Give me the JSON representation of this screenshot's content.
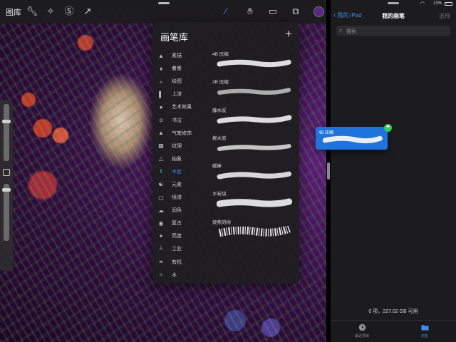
{
  "left_app": {
    "gallery_label": "图库",
    "toolbar_icons": [
      "wrench-icon",
      "magic-wand-icon",
      "selection-icon",
      "transform-arrow-icon"
    ],
    "right_tools": [
      "brush-icon",
      "smudge-icon",
      "eraser-icon",
      "layers-icon"
    ],
    "current_color": "#5b2686"
  },
  "brush_library": {
    "title": "画笔库",
    "add_label": "+",
    "categories": [
      {
        "label": "素描",
        "icon": "pencil-tip-icon"
      },
      {
        "label": "着墨",
        "icon": "ink-drop-icon"
      },
      {
        "label": "绘图",
        "icon": "swirl-icon"
      },
      {
        "label": "上漆",
        "icon": "paint-brush-icon"
      },
      {
        "label": "艺术效果",
        "icon": "palette-icon"
      },
      {
        "label": "书法",
        "icon": "calligraphy-icon"
      },
      {
        "label": "气笔修饰",
        "icon": "airbrush-icon"
      },
      {
        "label": "纹理",
        "icon": "texture-icon"
      },
      {
        "label": "抽象",
        "icon": "triangle-icon"
      },
      {
        "label": "木炭",
        "icon": "charcoal-icon"
      },
      {
        "label": "元素",
        "icon": "yin-yang-icon"
      },
      {
        "label": "喷漆",
        "icon": "spray-can-icon"
      },
      {
        "label": "润色",
        "icon": "cloud-icon"
      },
      {
        "label": "复古",
        "icon": "retro-icon"
      },
      {
        "label": "亮度",
        "icon": "sparkle-icon"
      },
      {
        "label": "工业",
        "icon": "anvil-icon"
      },
      {
        "label": "有机",
        "icon": "leaf-icon"
      },
      {
        "label": "水",
        "icon": "waves-icon"
      }
    ],
    "active_category": "木炭",
    "brushes": [
      {
        "name": "4B 压缩"
      },
      {
        "name": "2B 压缩"
      },
      {
        "name": "藤木炭"
      },
      {
        "name": "柳木炭"
      },
      {
        "name": "碳棒"
      },
      {
        "name": "木炭块"
      },
      {
        "name": "烧焦的树"
      }
    ]
  },
  "files_app": {
    "status": {
      "battery": "13%"
    },
    "back_label": "我的 iPad",
    "title": "我的画笔",
    "select_label": "选择",
    "search_placeholder": "搜索",
    "storage_info": "0 项，227.02 GB 可用",
    "tabs": [
      {
        "label": "最近项目",
        "icon": "clock-icon"
      },
      {
        "label": "浏览",
        "icon": "folder-icon"
      }
    ]
  },
  "drag_preview": {
    "name": "4B 压缩",
    "badge": "+"
  },
  "colors": {
    "accent": "#3a8ef0",
    "drag_bg": "#1e73dd",
    "badge": "#34c759"
  }
}
